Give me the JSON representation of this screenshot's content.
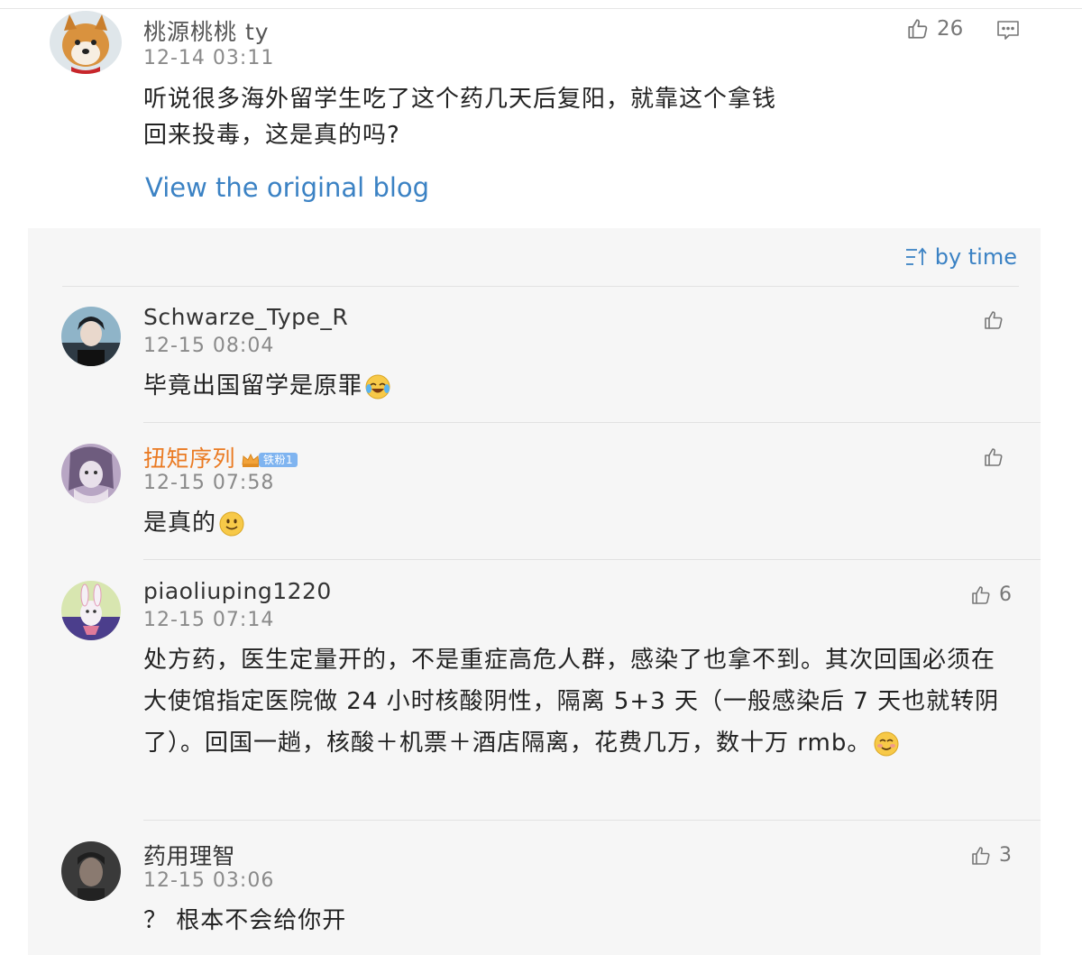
{
  "main_comment": {
    "username": "桃源桃桃 ty",
    "timestamp": "12-14 03:11",
    "like_count": "26",
    "text": "听说很多海外留学生吃了这个药几天后复阳，就靠这个拿钱回来投毒，这是真的吗?",
    "view_link": "View the original blog",
    "avatar_icon": "shiba-dog-avatar"
  },
  "sort": {
    "label": "by time",
    "icon": "sort-icon"
  },
  "replies": [
    {
      "username": "Schwarze_Type_R",
      "timestamp": "12-15 08:04",
      "text": "毕竟出国留学是原罪",
      "emoji": "laughing-crying-emoji",
      "like_count": ""
    },
    {
      "username": "扭矩序列",
      "username_color": "#ea7a22",
      "badge": "铁粉1",
      "timestamp": "12-15 07:58",
      "text": "是真的",
      "emoji": "smile-emoji",
      "like_count": ""
    },
    {
      "username": "piaoliuping1220",
      "timestamp": "12-15 07:14",
      "text": "处方药，医生定量开的，不是重症高危人群，感染了也拿不到。其次回国必须在大使馆指定医院做 24 小时核酸阴性，隔离 5+3 天（一般感染后 7 天也就转阴了）。回国一趟，核酸＋机票＋酒店隔离，花费几万，数十万 rmb。",
      "emoji": "blush-emoji",
      "like_count": "6"
    },
    {
      "username": "药用理智",
      "timestamp": "12-15 03:06",
      "text": "？ 根本不会给你开",
      "like_count": "3"
    }
  ],
  "colors": {
    "link": "#3b82c4",
    "panel_bg": "#f6f6f6",
    "highlight_name": "#ea7a22"
  }
}
